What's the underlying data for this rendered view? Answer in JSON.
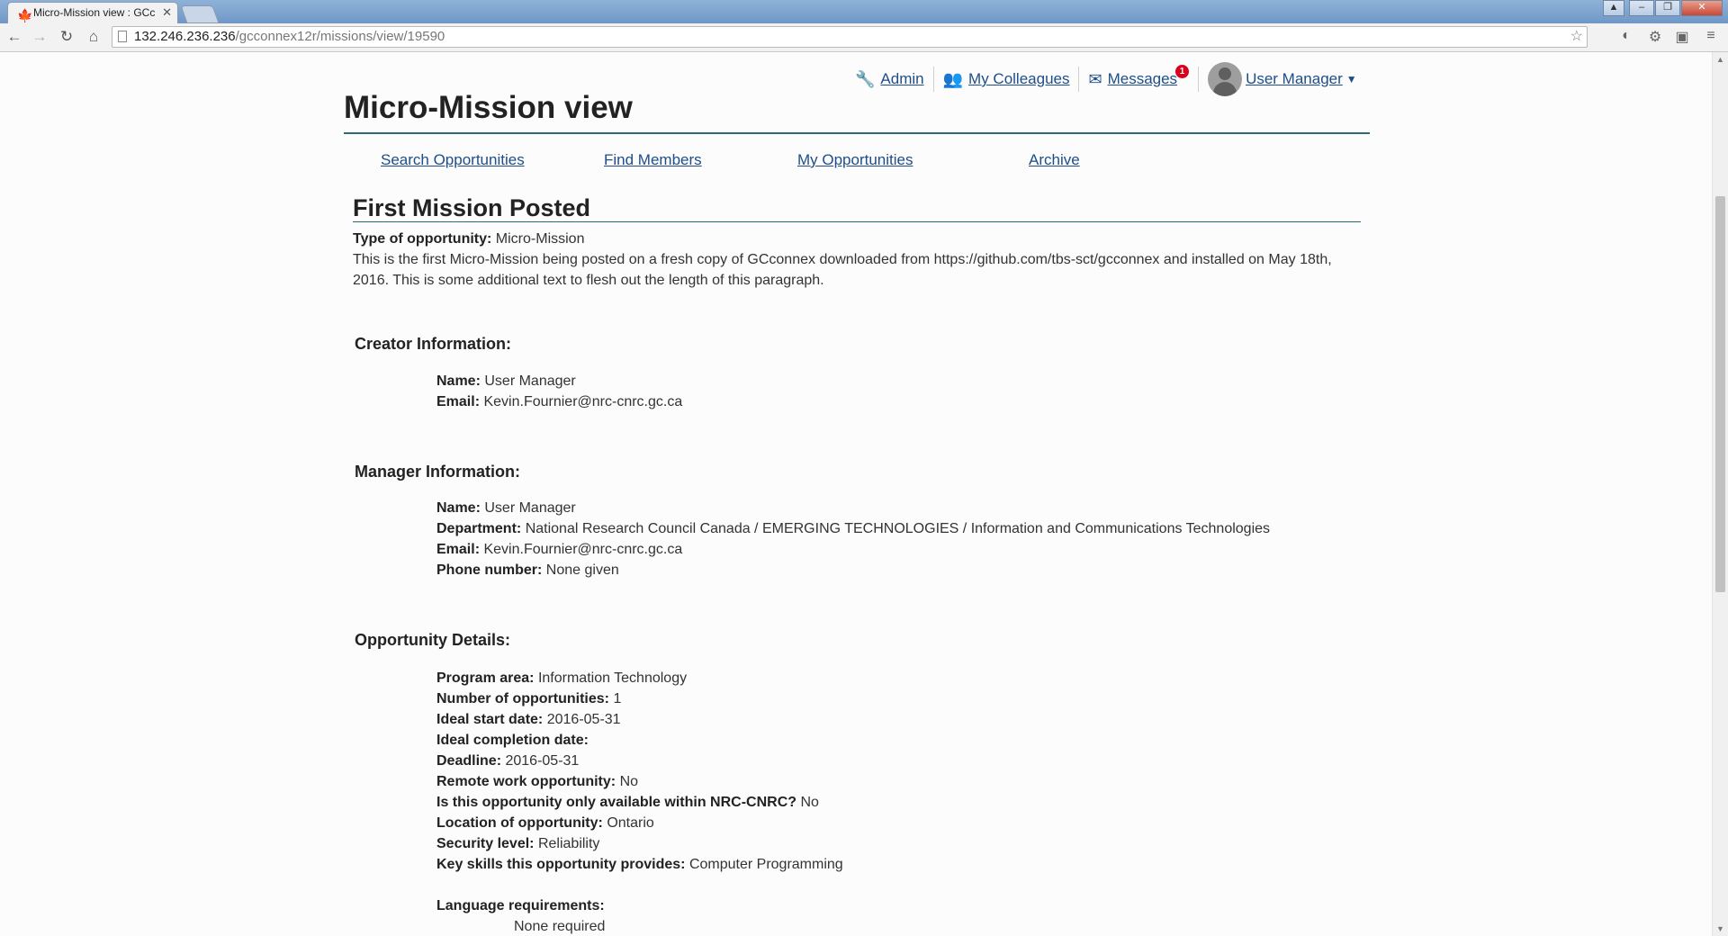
{
  "browser": {
    "tab_title": "Micro-Mission view : GCc",
    "url_host": "132.246.236.236",
    "url_path": "/gcconnex12r/missions/view/19590"
  },
  "userbar": {
    "admin": "Admin",
    "colleagues": "My Colleagues",
    "messages": "Messages",
    "messages_count": "1",
    "user": "User Manager"
  },
  "page": {
    "title": "Micro-Mission view",
    "subnav": [
      "Search Opportunities",
      "Find Members",
      "My Opportunities",
      "Archive"
    ]
  },
  "mission": {
    "title": "First Mission Posted",
    "type_label": "Type of opportunity:",
    "type_value": "Micro-Mission",
    "description": "This is the first Micro-Mission being posted on a fresh copy of GCconnex downloaded from https://github.com/tbs-sct/gcconnex and installed on May 18th, 2016. This is some additional text to flesh out the length of this paragraph."
  },
  "creator": {
    "heading": "Creator Information:",
    "fields": [
      {
        "label": "Name:",
        "value": "User Manager"
      },
      {
        "label": "Email:",
        "value": "Kevin.Fournier@nrc-cnrc.gc.ca"
      }
    ]
  },
  "manager": {
    "heading": "Manager Information:",
    "fields": [
      {
        "label": "Name:",
        "value": "User Manager"
      },
      {
        "label": "Department:",
        "value": "National Research Council Canada / EMERGING TECHNOLOGIES / Information and Communications Technologies"
      },
      {
        "label": "Email:",
        "value": "Kevin.Fournier@nrc-cnrc.gc.ca"
      },
      {
        "label": "Phone number:",
        "value": "None given"
      }
    ]
  },
  "details": {
    "heading": "Opportunity Details:",
    "fields": [
      {
        "label": "Program area:",
        "value": "Information Technology"
      },
      {
        "label": "Number of opportunities:",
        "value": "1"
      },
      {
        "label": "Ideal start date:",
        "value": "2016-05-31"
      },
      {
        "label": "Ideal completion date:",
        "value": ""
      },
      {
        "label": "Deadline:",
        "value": "2016-05-31"
      },
      {
        "label": "Remote work opportunity:",
        "value": "No"
      },
      {
        "label": "Is this opportunity only available within NRC-CNRC?",
        "value": "No"
      },
      {
        "label": "Location of opportunity:",
        "value": "Ontario"
      },
      {
        "label": "Security level:",
        "value": "Reliability"
      },
      {
        "label": "Key skills this opportunity provides:",
        "value": "Computer Programming"
      }
    ],
    "language_label": "Language requirements:",
    "language_value": "None required"
  }
}
